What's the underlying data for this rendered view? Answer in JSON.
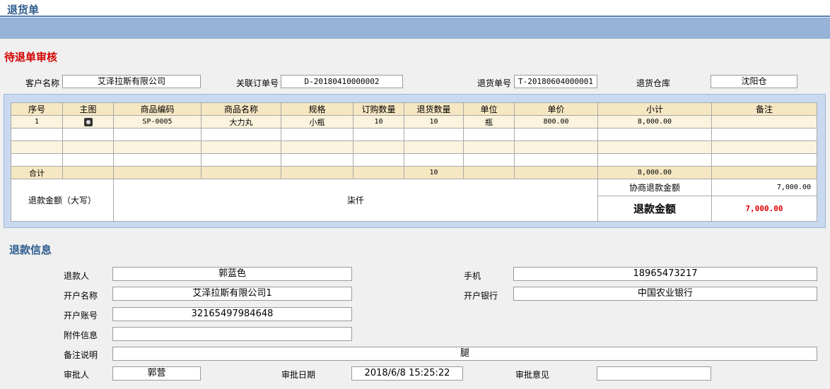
{
  "window": {
    "title": "退货单"
  },
  "section_title": "待退单审核",
  "header": {
    "customer_label": "客户名称",
    "customer_value": "艾泽拉斯有限公司",
    "order_label": "关联订单号",
    "order_value": "D-20180410000002",
    "return_no_label": "退货单号",
    "return_no_value": "T-20180604000001",
    "warehouse_label": "退货仓库",
    "warehouse_value": "沈阳仓"
  },
  "table": {
    "columns": [
      "序号",
      "主图",
      "商品编码",
      "商品名称",
      "规格",
      "订购数量",
      "退货数量",
      "单位",
      "单价",
      "小计",
      "备注"
    ],
    "rows": [
      {
        "no": "1",
        "image_icon": "product-image-icon",
        "code": "SP-0005",
        "name": "大力丸",
        "spec": "小瓶",
        "order_qty": "10",
        "return_qty": "10",
        "unit": "瓶",
        "price": "800.00",
        "subtotal": "8,000.00",
        "remark": ""
      }
    ],
    "total": {
      "label": "合计",
      "return_qty": "10",
      "subtotal": "8,000.00"
    },
    "refund_caps_label": "退款金额（大写）",
    "refund_caps_value": "柒仟",
    "negotiated_label": "协商退款金额",
    "negotiated_value": "7,000.00",
    "refund_amount_label": "退款金额",
    "refund_amount_value": "7,000.00"
  },
  "refund_info": {
    "title": "退款信息",
    "refunder_label": "退款人",
    "refunder_value": "郭蓝色",
    "phone_label": "手机",
    "phone_value": "18965473217",
    "account_name_label": "开户名称",
    "account_name_value": "艾泽拉斯有限公司1",
    "bank_label": "开户银行",
    "bank_value": "中国农业银行",
    "account_no_label": "开户账号",
    "account_no_value": "32165497984648",
    "attachment_label": "附件信息",
    "attachment_value": "",
    "remark_label": "备注说明",
    "remark_value": "腿",
    "approver_label": "审批人",
    "approver_value": "郭营",
    "approve_date_label": "审批日期",
    "approve_date_value": "2018/6/8 15:25:22",
    "opinion_label": "审批意见",
    "opinion_value": ""
  },
  "colors": {
    "title_blue": "#2e5d8e",
    "section_red": "#d40000",
    "header_band": "#97b4d8",
    "amount_red": "#e00000"
  }
}
